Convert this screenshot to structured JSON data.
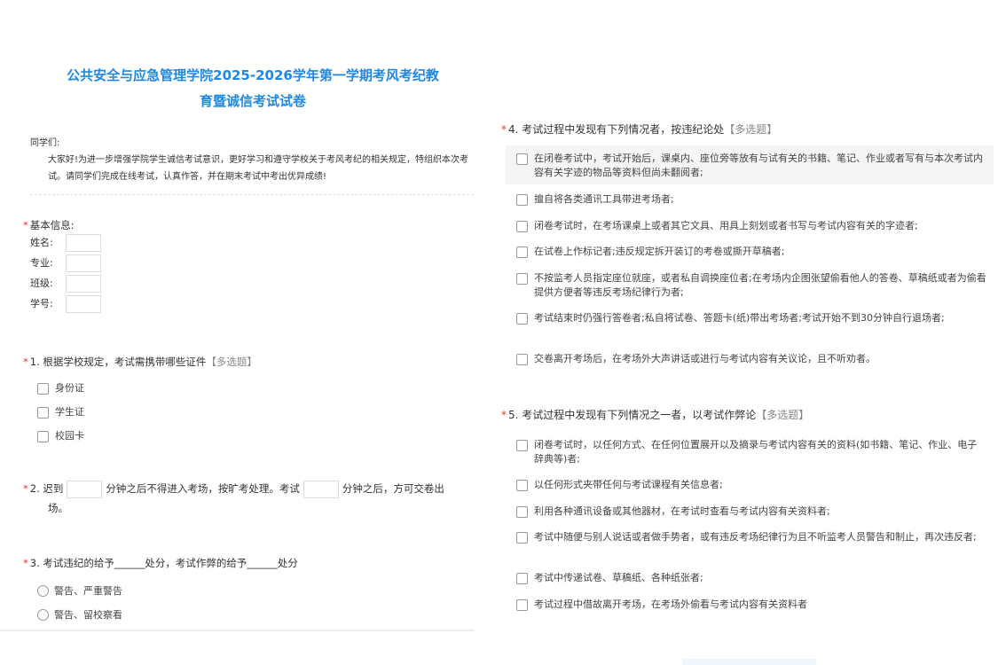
{
  "title_line1": "公共安全与应急管理学院2025-2026学年第一学期考风考纪教",
  "title_line2": "育暨诚信考试试卷",
  "greeting": "同学们:",
  "intro": "大家好!为进一步增强学院学生诚信考试意识，更好学习和遵守学校关于考风考纪的相关规定，特组织本次考试。请同学们完成在线考试，认真作答，并在期末考试中考出优异成绩!",
  "required_mark": "*",
  "basic_info": {
    "label": "基本信息:",
    "fields": [
      "姓名:",
      "专业:",
      "班级:",
      "学号:"
    ]
  },
  "q1": {
    "label": "1. 根据学校规定，考试需携带哪些证件",
    "tag": "【多选题】",
    "options": [
      "身份证",
      "学生证",
      "校园卡"
    ]
  },
  "q2": {
    "num": "2.",
    "part1": "迟到",
    "part2": "分钟之后不得进入考场，按旷考处理。考试",
    "part3": "分钟之后，方可交卷出",
    "part4": "场。"
  },
  "q3": {
    "label": "3. 考试违纪的给予______处分，考试作弊的给予______处分",
    "options": [
      "警告、严重警告",
      "警告、留校察看"
    ]
  },
  "q4": {
    "label": "4. 考试过程中发现有下列情况者，按违纪论处",
    "tag": "【多选题】",
    "options": [
      "在闭卷考试中，考试开始后，课桌内、座位旁等放有与试有关的书籍、笔记、作业或者写有与本次考试内容有关字迹的物品等资料但尚未翻阅者;",
      "擅自将各类通讯工具带进考场者;",
      "闭卷考试时，在考场课桌上或者其它文具、用具上刻划或者书写与考试内容有关的字迹者;",
      "在试卷上作标记者;违反规定拆开装订的考卷或撕开草稿者;",
      "不按监考人员指定座位就座，或者私自调换座位者;在考场内企图张望偷看他人的答卷、草稿纸或者为偷看提供方便者等违反考场纪律行为者;",
      "考试结束时仍强行答卷者;私自将试卷、答题卡(纸)带出考场者;考试开始不到30分钟自行退场者;",
      "交卷离开考场后，在考场外大声讲话或进行与考试内容有关议论，且不听劝者。"
    ]
  },
  "q5": {
    "label": "5. 考试过程中发现有下列情况之一者，以考试作弊论",
    "tag": "【多选题】",
    "options": [
      "闭卷考试时，以任何方式、在任何位置展开以及摘录与考试内容有关的资料(如书籍、笔记、作业、电子辞典等)者;",
      "以任何形式夹带任何与考试课程有关信息者;",
      "利用各种通讯设备或其他器材，在考试时查看与考试内容有关资料者;",
      "考试中随便与别人说话或者做手势者，或有违反考场纪律行为且不听监考人员警告和制止，再次违反者;",
      "考试中传递试卷、草稿纸、各种纸张者;",
      "考试过程中借故离开考场，在考场外偷看与考试内容有关资料者"
    ]
  }
}
